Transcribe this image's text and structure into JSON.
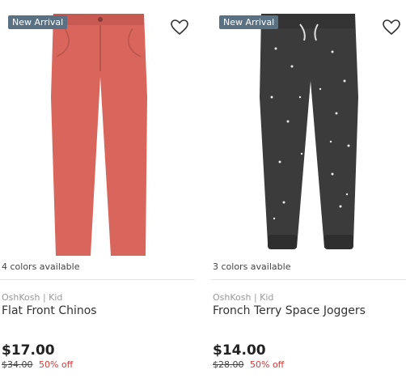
{
  "products": [
    {
      "badge": "New Arrival",
      "colors_available": "4 colors available",
      "brand": "OshKosh | Kid",
      "name": "Flat Front Chinos",
      "price": "$17.00",
      "original_price": "$34.00",
      "discount": "50% off",
      "image": "coral-chino-pants",
      "image_color": "#d9665d"
    },
    {
      "badge": "New Arrival",
      "colors_available": "3 colors available",
      "brand": "OshKosh | Kid",
      "name": "Fronch Terry Space Joggers",
      "price": "$14.00",
      "original_price": "$28.00",
      "discount": "50% off",
      "image": "charcoal-space-joggers",
      "image_color": "#3b3b3b"
    }
  ],
  "icons": {
    "favorite": "heart-outline-icon"
  },
  "colors": {
    "badge_bg": "#5a7184",
    "discount": "#d23b3b"
  }
}
